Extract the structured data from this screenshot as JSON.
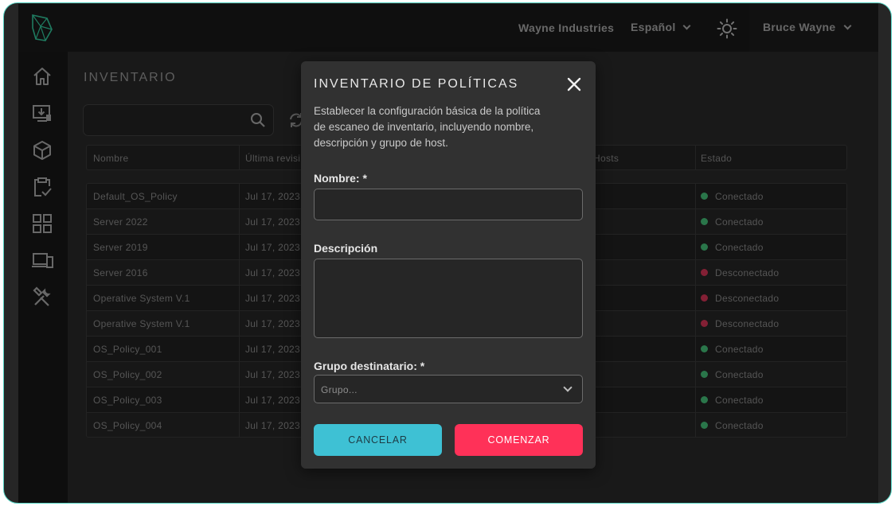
{
  "topbar": {
    "org": "Wayne Industries",
    "language": "Español",
    "user": "Bruce Wayne"
  },
  "sidebar": {
    "icons": [
      "home-icon",
      "download-device-icon",
      "cube-icon",
      "clipboard-check-icon",
      "grid-icon",
      "devices-icon",
      "tools-icon"
    ]
  },
  "main": {
    "title": "INVENTARIO",
    "search": {
      "placeholder": ""
    },
    "table": {
      "headers": {
        "name": "Nombre",
        "last": "Última revisi",
        "hosts": "Hosts",
        "status": "Estado"
      },
      "rows": [
        {
          "name": "Default_OS_Policy",
          "date": "Jul 17, 2023",
          "status": "Conectado",
          "status_color": "#3fae6e"
        },
        {
          "name": "Server 2022",
          "date": "Jul 17, 2023",
          "status": "Conectado",
          "status_color": "#3fae6e"
        },
        {
          "name": "Server 2019",
          "date": "Jul 17, 2023",
          "status": "Conectado",
          "status_color": "#3fae6e"
        },
        {
          "name": "Server 2016",
          "date": "Jul 17, 2023",
          "status": "Desconectado",
          "status_color": "#c2304e"
        },
        {
          "name": "Operative System V.1",
          "date": "Jul 17, 2023",
          "status": "Desconectado",
          "status_color": "#c2304e"
        },
        {
          "name": "Operative System V.1",
          "date": "Jul 17, 2023",
          "status": "Desconectado",
          "status_color": "#c2304e"
        },
        {
          "name": "OS_Policy_001",
          "date": "Jul 17, 2023",
          "status": "Conectado",
          "status_color": "#3fae6e"
        },
        {
          "name": "OS_Policy_002",
          "date": "Jul 17, 2023",
          "status": "Conectado",
          "status_color": "#3fae6e"
        },
        {
          "name": "OS_Policy_003",
          "date": "Jul 17, 2023",
          "status": "Conectado",
          "status_color": "#3fae6e"
        },
        {
          "name": "OS_Policy_004",
          "date": "Jul 17, 2023",
          "status": "Conectado",
          "status_color": "#3fae6e"
        }
      ]
    }
  },
  "modal": {
    "title": "INVENTARIO DE POLÍTICAS",
    "description": "Establecer la configuración básica de la política de escaneo de inventario, incluyendo nombre, descripción y grupo de host.",
    "name_label": "Nombre: *",
    "name_value": "",
    "desc_label": "Descripción",
    "desc_value": "",
    "group_label": "Grupo destinatario: *",
    "group_placeholder": "Grupo...",
    "cancel": "CANCELAR",
    "start": "COMENZAR"
  },
  "colors": {
    "accent_cyan": "#3ec1d4",
    "accent_red": "#ff3158",
    "connected": "#3fae6e",
    "disconnected": "#c2304e",
    "frame_border": "#57d3c3"
  }
}
